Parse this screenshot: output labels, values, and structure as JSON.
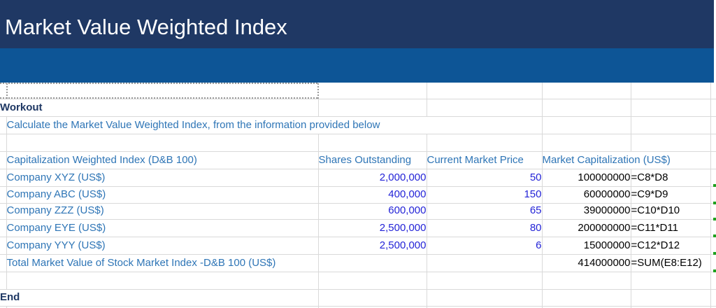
{
  "banner": {
    "title": "Market Value Weighted Index"
  },
  "workout": {
    "heading": "Workout",
    "instruction": "Calculate the Market Value Weighted Index, from the information provided below"
  },
  "table": {
    "headers": {
      "company": "Capitalization Weighted Index (D&B 100)",
      "shares": "Shares Outstanding",
      "price": "Current Market Price",
      "mcap": "Market Capitalization (US$)"
    },
    "rows": [
      {
        "label": "Company XYZ (US$)",
        "shares": "2,000,000",
        "price": "50",
        "mcap": "100000000",
        "formula": "=C8*D8"
      },
      {
        "label": "Company ABC (US$)",
        "shares": "400,000",
        "price": "150",
        "mcap": "60000000",
        "formula": "=C9*D9"
      },
      {
        "label": "Company ZZZ (US$)",
        "shares": "600,000",
        "price": "65",
        "mcap": "39000000",
        "formula": "=C10*D10"
      },
      {
        "label": "Company EYE (US$)",
        "shares": "2,500,000",
        "price": "80",
        "mcap": "200000000",
        "formula": "=C11*D11"
      },
      {
        "label": "Company YYY (US$)",
        "shares": "2,500,000",
        "price": "6",
        "mcap": "15000000",
        "formula": "=C12*D12"
      }
    ],
    "total": {
      "label": "Total Market Value of Stock Market Index -D&B 100 (US$)",
      "mcap": "414000000",
      "formula": "=SUM(E8:E12)"
    }
  },
  "footer": {
    "end_label": "End"
  },
  "colors": {
    "banner_navy": "#1F3864",
    "banner_blue": "#0D5596",
    "label_blue": "#2E75B6",
    "input_blue": "#2323D7",
    "value_black": "#000000",
    "heading_navy": "#1F3864",
    "gridline": "#D9D9D9",
    "marquee_gray": "#9A9A9A",
    "tick_green": "#1FA11F"
  }
}
